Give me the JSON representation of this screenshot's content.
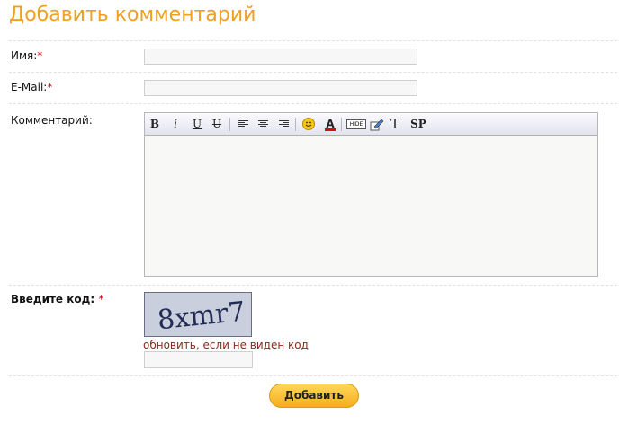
{
  "title": "Добавить комментарий",
  "form": {
    "name_label": "Имя:",
    "email_label": "E-Mail:",
    "comment_label": "Комментарий:",
    "code_label": "Введите код:",
    "required_mark": "*",
    "captcha_text": "8xmr7",
    "refresh_link": "обновить, если не виден код",
    "submit_label": "Добавить"
  },
  "toolbar": {
    "bold": "B",
    "italic": "i",
    "underline": "U",
    "strike": "U",
    "hide": "HIDE",
    "font": "T",
    "spoiler": "SP"
  },
  "colors": {
    "title": "#f0a020",
    "required": "#c00000",
    "refresh_link": "#8a2a1a",
    "submit_bg": "#f5ae1c"
  }
}
